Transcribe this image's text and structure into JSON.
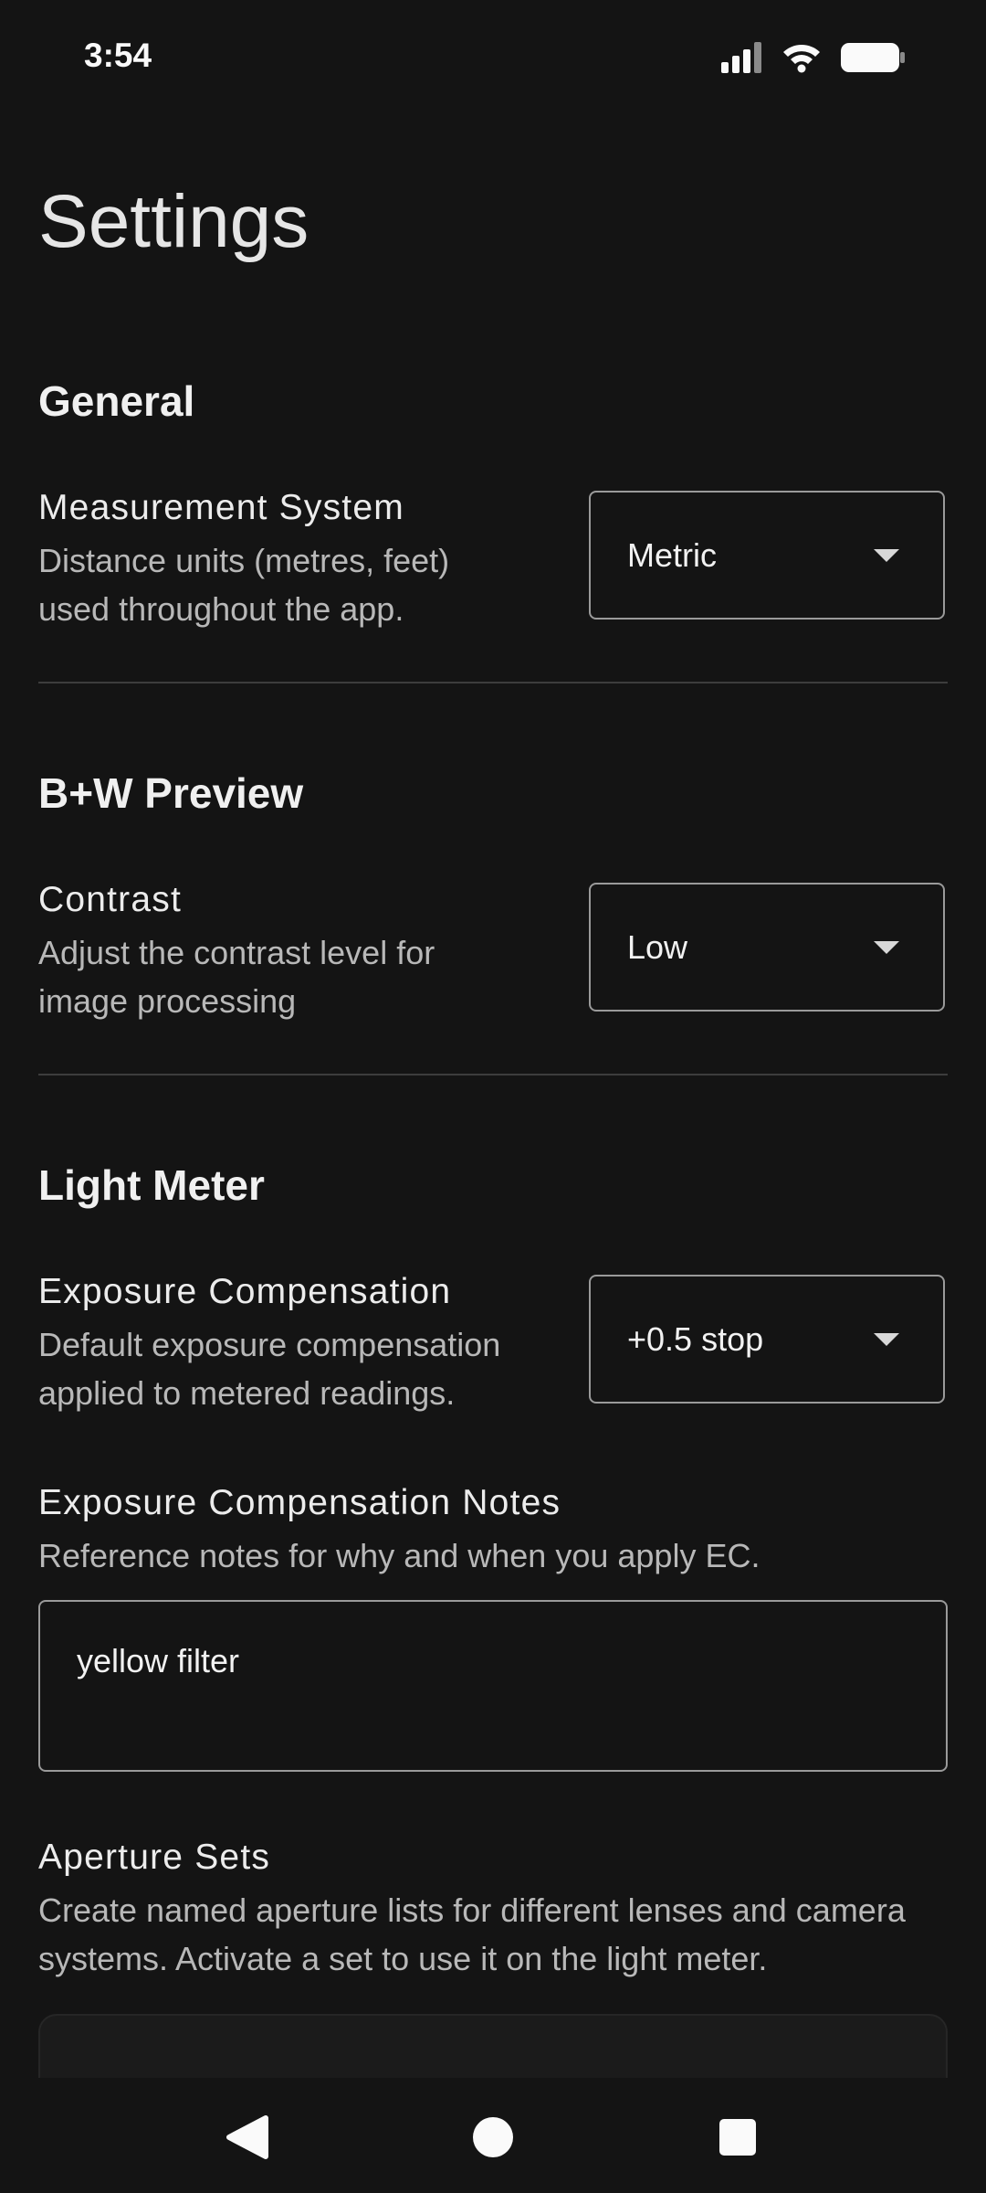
{
  "status_bar": {
    "time": "3:54"
  },
  "page": {
    "title": "Settings"
  },
  "sections": {
    "general": {
      "header": "General",
      "measurement": {
        "title": "Measurement System",
        "description_line1": "Distance units (metres, feet)",
        "description_line2": "used throughout the app.",
        "value": "Metric"
      }
    },
    "bw_preview": {
      "header": "B+W Preview",
      "contrast": {
        "title": "Contrast",
        "description_line1": "Adjust the contrast level for",
        "description_line2": "image processing",
        "value": "Low"
      }
    },
    "light_meter": {
      "header": "Light Meter",
      "exposure_comp": {
        "title": "Exposure Compensation",
        "description_line1": "Default exposure compensation",
        "description_line2": "applied to metered readings.",
        "value": "+0.5 stop"
      },
      "ec_notes": {
        "title": "Exposure Compensation Notes",
        "description": "Reference notes for why and when you apply EC.",
        "value": "yellow filter"
      },
      "aperture_sets": {
        "title": "Aperture Sets",
        "description_line1": "Create named aperture lists for different lenses and camera",
        "description_line2": "systems. Activate a set to use it on the light meter."
      }
    }
  },
  "icons": {
    "signal": "cellular-signal-icon",
    "wifi": "wifi-icon",
    "battery": "battery-icon",
    "back": "back-triangle-icon",
    "home": "home-circle-icon",
    "recents": "recents-square-icon"
  },
  "colors": {
    "background": "#141414",
    "text": "#ececec",
    "muted": "#b8b8b8",
    "border": "#9a9a9a"
  }
}
